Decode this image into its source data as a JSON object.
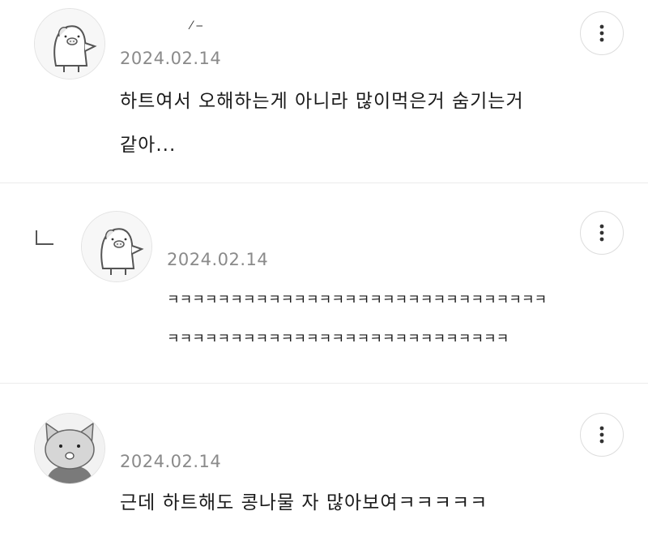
{
  "comments": [
    {
      "username": "ˎ⁄ ‒",
      "date": "2024.02.14",
      "text": "하트여서 오해하는게 아니라 많이먹은거 숨기는거\n같아...",
      "avatar_icon": "pig-character-avatar-icon",
      "menu_icon": "more-vertical-icon"
    },
    {
      "is_reply": true,
      "username": "ˎ",
      "date": "2024.02.14",
      "text": "ㅋㅋㅋㅋㅋㅋㅋㅋㅋㅋㅋㅋㅋㅋㅋㅋㅋㅋㅋㅋㅋㅋㅋㅋㅋㅋㅋㅋㅋㅋ\nㅋㅋㅋㅋㅋㅋㅋㅋㅋㅋㅋㅋㅋㅋㅋㅋㅋㅋㅋㅋㅋㅋㅋㅋㅋㅋㅋ",
      "avatar_icon": "pig-character-avatar-icon",
      "menu_icon": "more-vertical-icon"
    },
    {
      "username": "",
      "date": "2024.02.14",
      "text": "근데 하트해도 콩나물 자 많아보여ㅋㅋㅋㅋㅋ",
      "avatar_icon": "cat-character-avatar-icon",
      "menu_icon": "more-vertical-icon"
    }
  ]
}
